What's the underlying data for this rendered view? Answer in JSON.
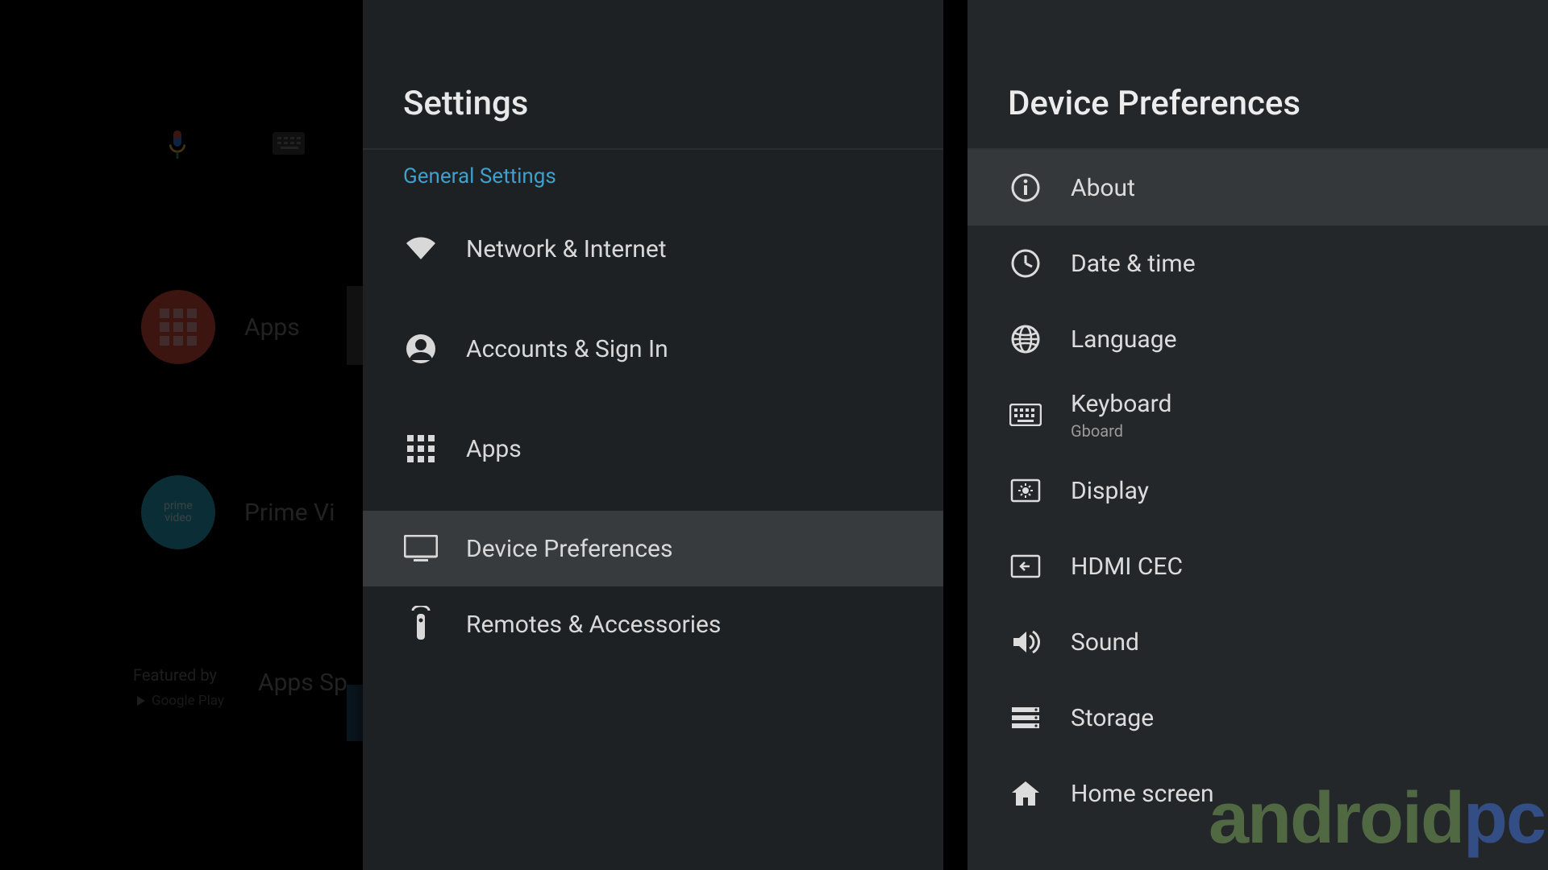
{
  "launcher": {
    "apps_label": "Apps",
    "prime_label": "Prime Vi",
    "featured_by": "Featured by",
    "google_play": "Google Play",
    "spotlight_label": "Apps Sp"
  },
  "settings": {
    "title": "Settings",
    "section": "General Settings",
    "items": {
      "network": "Network & Internet",
      "accounts": "Accounts & Sign In",
      "apps": "Apps",
      "device_prefs": "Device Preferences",
      "remotes": "Remotes & Accessories"
    }
  },
  "prefs": {
    "title": "Device Preferences",
    "items": {
      "about": "About",
      "date_time": "Date & time",
      "language": "Language",
      "keyboard": "Keyboard",
      "keyboard_sub": "Gboard",
      "display": "Display",
      "hdmi": "HDMI CEC",
      "sound": "Sound",
      "storage": "Storage",
      "home": "Home screen"
    }
  },
  "watermark": {
    "part1": "android",
    "part2": "pc"
  }
}
